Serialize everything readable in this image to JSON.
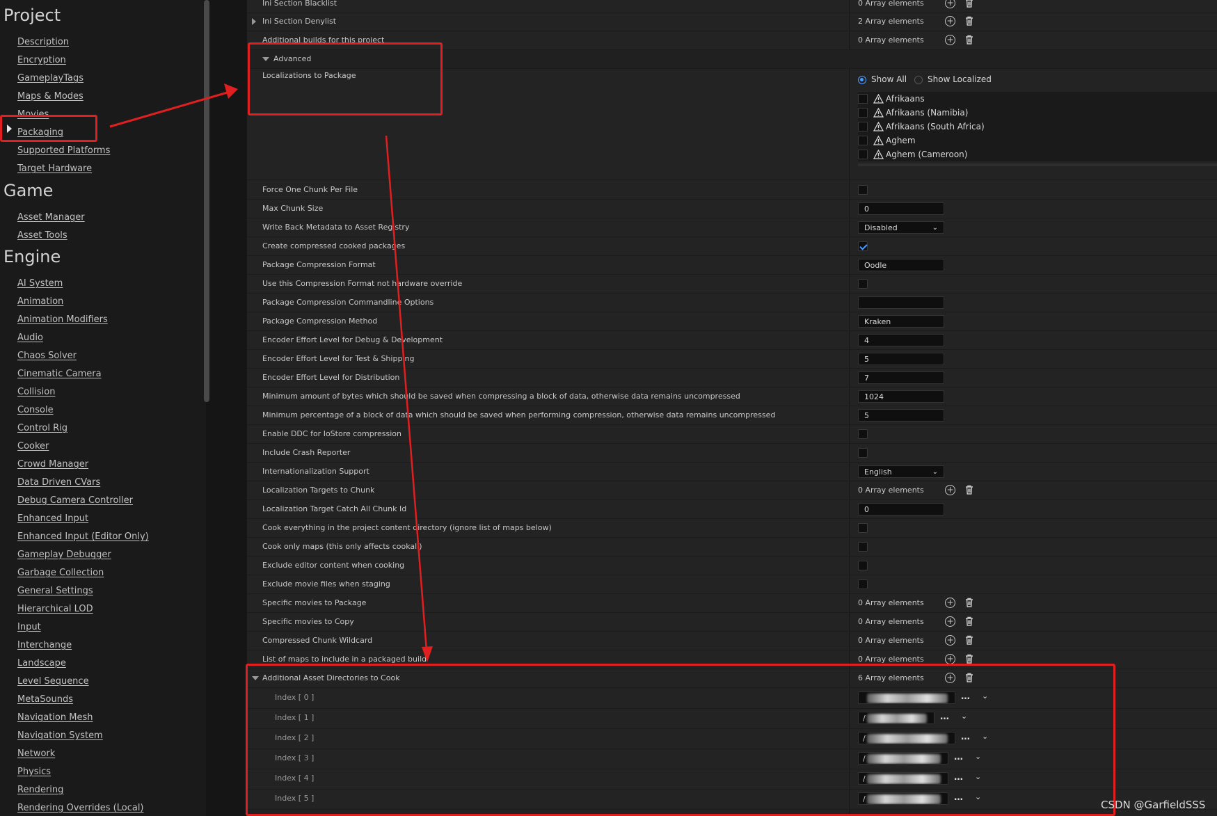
{
  "sidebar": {
    "sections": [
      {
        "title": "Project",
        "items": [
          "Description",
          "Encryption",
          "GameplayTags",
          "Maps & Modes",
          "Movies",
          "Packaging",
          "Supported Platforms",
          "Target Hardware"
        ]
      },
      {
        "title": "Game",
        "items": [
          "Asset Manager",
          "Asset Tools"
        ]
      },
      {
        "title": "Engine",
        "items": [
          "AI System",
          "Animation",
          "Animation Modifiers",
          "Audio",
          "Chaos Solver",
          "Cinematic Camera",
          "Collision",
          "Console",
          "Control Rig",
          "Cooker",
          "Crowd Manager",
          "Data Driven CVars",
          "Debug Camera Controller",
          "Enhanced Input",
          "Enhanced Input (Editor Only)",
          "Gameplay Debugger",
          "Garbage Collection",
          "General Settings",
          "Hierarchical LOD",
          "Input",
          "Interchange",
          "Landscape",
          "Level Sequence",
          "MetaSounds",
          "Navigation Mesh",
          "Navigation System",
          "Network",
          "Physics",
          "Rendering",
          "Rendering Overrides (Local)"
        ]
      }
    ],
    "selected": "Packaging"
  },
  "top_rows": [
    {
      "label": "Ini Section Blacklist",
      "value": "0 Array elements"
    },
    {
      "label": "Ini Section Denylist",
      "value": "2 Array elements"
    },
    {
      "label": "Additional builds for this project",
      "value": "0 Array elements"
    }
  ],
  "advanced": {
    "label": "Advanced",
    "localizations_label": "Localizations to Package",
    "filter_show_all": "Show All",
    "filter_show_localized": "Show Localized",
    "languages": [
      "Afrikaans",
      "Afrikaans (Namibia)",
      "Afrikaans (South Africa)",
      "Aghem",
      "Aghem (Cameroon)"
    ]
  },
  "settings": [
    {
      "label": "Force One Chunk Per File",
      "type": "check",
      "checked": false
    },
    {
      "label": "Max Chunk Size",
      "type": "text",
      "value": "0"
    },
    {
      "label": "Write Back Metadata to Asset Registry",
      "type": "combo",
      "value": "Disabled"
    },
    {
      "label": "Create compressed cooked packages",
      "type": "check",
      "checked": true
    },
    {
      "label": "Package Compression Format",
      "type": "text",
      "value": "Oodle"
    },
    {
      "label": "Use this Compression Format not hardware override",
      "type": "check",
      "checked": false
    },
    {
      "label": "Package Compression Commandline Options",
      "type": "text",
      "value": ""
    },
    {
      "label": "Package Compression Method",
      "type": "text",
      "value": "Kraken"
    },
    {
      "label": "Encoder Effort Level for Debug & Development",
      "type": "text",
      "value": "4"
    },
    {
      "label": "Encoder Effort Level for Test & Shipping",
      "type": "text",
      "value": "5"
    },
    {
      "label": "Encoder Effort Level for Distribution",
      "type": "text",
      "value": "7"
    },
    {
      "label": "Minimum amount of bytes which should be saved when compressing a block of data, otherwise data remains uncompressed",
      "type": "text",
      "value": "1024"
    },
    {
      "label": "Minimum percentage of a block of data which should be saved when performing compression, otherwise data remains uncompressed",
      "type": "text",
      "value": "5"
    },
    {
      "label": "Enable DDC for IoStore compression",
      "type": "check",
      "checked": false
    },
    {
      "label": "Include Crash Reporter",
      "type": "check",
      "checked": false
    },
    {
      "label": "Internationalization Support",
      "type": "combo",
      "value": "English"
    },
    {
      "label": "Localization Targets to Chunk",
      "type": "array",
      "value": "0 Array elements"
    },
    {
      "label": "Localization Target Catch All Chunk Id",
      "type": "text",
      "value": "0"
    },
    {
      "label": "Cook everything in the project content directory (ignore list of maps below)",
      "type": "check",
      "checked": false
    },
    {
      "label": "Cook only maps (this only affects cookall)",
      "type": "check",
      "checked": false
    },
    {
      "label": "Exclude editor content when cooking",
      "type": "check",
      "checked": false
    },
    {
      "label": "Exclude movie files when staging",
      "type": "check",
      "checked": false
    },
    {
      "label": "Specific movies to Package",
      "type": "array",
      "value": "0 Array elements"
    },
    {
      "label": "Specific movies to Copy",
      "type": "array",
      "value": "0 Array elements"
    },
    {
      "label": "Compressed Chunk Wildcard",
      "type": "array",
      "value": "0 Array elements"
    },
    {
      "label": "List of maps to include in a packaged build",
      "type": "array",
      "value": "0 Array elements"
    }
  ],
  "asset_dirs": {
    "label": "Additional Asset Directories to Cook",
    "value": "6 Array elements",
    "entries": [
      {
        "index": "Index [ 0 ]",
        "visible": ""
      },
      {
        "index": "Index [ 1 ]",
        "visible": "/"
      },
      {
        "index": "Index [ 2 ]",
        "visible": "/"
      },
      {
        "index": "Index [ 3 ]",
        "visible": "/"
      },
      {
        "index": "Index [ 4 ]",
        "visible": "/"
      },
      {
        "index": "Index [ 5 ]",
        "visible": "/"
      }
    ]
  },
  "watermark": "CSDN @GarfieldSSS",
  "colors": {
    "annotation": "#e02020",
    "accent": "#4d9cff",
    "panel": "#232323",
    "sidebar": "#1a1a1a"
  }
}
